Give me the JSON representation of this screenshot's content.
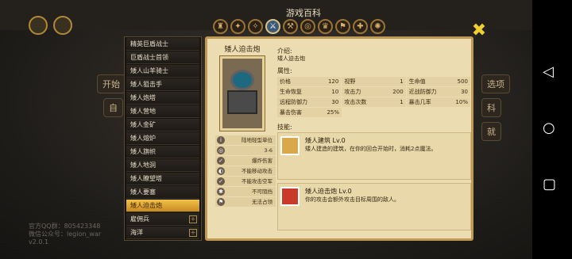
{
  "window_title": "游戏百科",
  "background": {
    "buttons": [
      "开始",
      "自",
      "选项",
      "科",
      "就"
    ],
    "footer_lines": [
      "官方QQ群：805423348",
      "微信公众号：legion_war",
      "v2.0.1"
    ]
  },
  "category_tabs": [
    {
      "name": "helmet-icon",
      "glyph": "♜"
    },
    {
      "name": "axe-icon",
      "glyph": "✦"
    },
    {
      "name": "claw-icon",
      "glyph": "✧"
    },
    {
      "name": "sword-icon",
      "glyph": "⚔"
    },
    {
      "name": "hammer-icon",
      "glyph": "⚒"
    },
    {
      "name": "spiral-icon",
      "glyph": "◎"
    },
    {
      "name": "crown-icon",
      "glyph": "♛"
    },
    {
      "name": "banner-icon",
      "glyph": "⚑"
    },
    {
      "name": "cross-icon",
      "glyph": "✚"
    },
    {
      "name": "gear-icon",
      "glyph": "✺"
    }
  ],
  "sidebar": {
    "items": [
      {
        "label": "精英巨盾战士"
      },
      {
        "label": "巨盾战士首领"
      },
      {
        "label": "矮人山羊骑士"
      },
      {
        "label": "矮人狙击手"
      },
      {
        "label": "矮人炮塔"
      },
      {
        "label": "矮人营地"
      },
      {
        "label": "矮人金矿"
      },
      {
        "label": "矮人熔炉"
      },
      {
        "label": "矮人旗帜"
      },
      {
        "label": "矮人地洞"
      },
      {
        "label": "矮人瞭望塔"
      },
      {
        "label": "矮人要塞"
      },
      {
        "label": "矮人迫击炮"
      },
      {
        "label": "雇佣兵"
      },
      {
        "label": "海洋"
      }
    ],
    "active_index": 12
  },
  "unit": {
    "name": "矮人迫击炮",
    "tags": [
      "陆地轻型单位",
      "3-6",
      "爆炸伤害",
      "不能移动攻击",
      "不能攻击空军",
      "不可阻挡",
      "无法占领"
    ],
    "intro_label": "介绍:",
    "intro_text": "矮人迫击炮",
    "attr_label": "属性:",
    "stats": [
      [
        {
          "k": "价格",
          "v": "120"
        },
        {
          "k": "视野",
          "v": "1"
        },
        {
          "k": "生命值",
          "v": "500"
        }
      ],
      [
        {
          "k": "生命恢复",
          "v": "10"
        },
        {
          "k": "攻击力",
          "v": "200"
        },
        {
          "k": "近战防御力",
          "v": "30"
        }
      ],
      [
        {
          "k": "远程防御力",
          "v": "30"
        },
        {
          "k": "攻击次数",
          "v": "1"
        },
        {
          "k": "暴击几率",
          "v": "10%"
        }
      ],
      [
        {
          "k": "暴击伤害",
          "v": "25%"
        }
      ]
    ],
    "skill_label": "技能:",
    "skills": [
      {
        "name": "矮人建筑 Lv.0",
        "desc": "矮人建造的建筑，在你的回合开始时，消耗2点魔法。",
        "color": "#d9a84a"
      },
      {
        "name": "矮人迫击炮 Lv.0",
        "desc": "你的攻击会额外攻击目标周围的敌人。",
        "color": "#c83a2a"
      }
    ]
  },
  "android_nav": {
    "back": "◁",
    "home": "○",
    "recent": "▢"
  }
}
